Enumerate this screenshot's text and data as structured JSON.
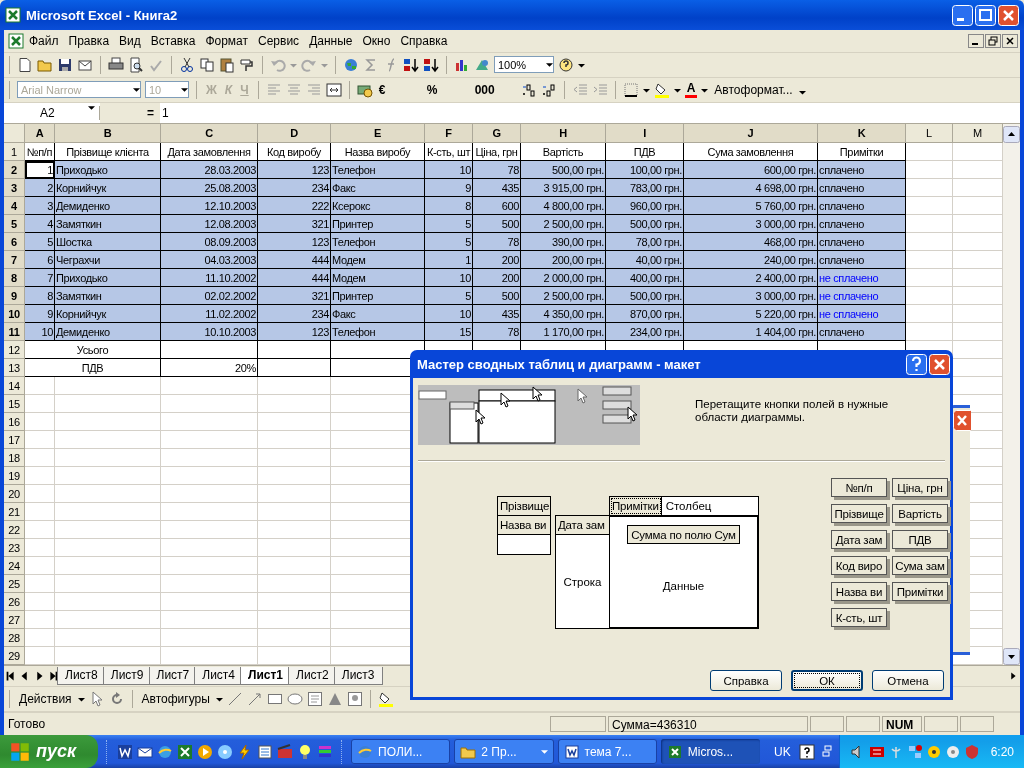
{
  "window": {
    "title": "Microsoft Excel - Книга2"
  },
  "menu": [
    "Файл",
    "Правка",
    "Вид",
    "Вставка",
    "Формат",
    "Сервис",
    "Данные",
    "Окно",
    "Справка"
  ],
  "standard_toolbar": {
    "zoom": "100%"
  },
  "formatting_toolbar": {
    "font": "Arial Narrow",
    "size": "10",
    "disabled": true,
    "style_buttons": [
      "Ж",
      "К",
      "Ч"
    ],
    "number_buttons": [
      "€",
      "%",
      "000"
    ],
    "font_color_button": "A",
    "autoformat": "Автоформат..."
  },
  "formula_bar": {
    "name_box": "A2",
    "equals": "=",
    "value": "1"
  },
  "sheet": {
    "columns": [
      {
        "label": "A",
        "selected": true
      },
      {
        "label": "B",
        "selected": true
      },
      {
        "label": "C",
        "selected": true
      },
      {
        "label": "D",
        "selected": true
      },
      {
        "label": "E",
        "selected": true
      },
      {
        "label": "F",
        "selected": true
      },
      {
        "label": "G",
        "selected": true
      },
      {
        "label": "H",
        "selected": true
      },
      {
        "label": "I",
        "selected": true
      },
      {
        "label": "J",
        "selected": true
      },
      {
        "label": "K",
        "selected": true
      },
      {
        "label": "L",
        "selected": false
      },
      {
        "label": "M",
        "selected": false
      }
    ],
    "rows": [
      {
        "n": "1",
        "kind": "header",
        "selected": false,
        "cells": [
          "№п/п",
          "Прізвище клієнта",
          "Дата замовлення",
          "Код виробу",
          "Назва виробу",
          "К-сть, шт",
          "Ціна, грн",
          "Вартість",
          "ПДВ",
          "Сума замовлення",
          "Примітки"
        ]
      },
      {
        "n": "2",
        "kind": "data",
        "selected": true,
        "active_cell": true,
        "flagged": false,
        "cells": [
          "1",
          "Приходько",
          "28.03.2003",
          "123",
          "Телефон",
          "10",
          "78",
          "500,00 грн.",
          "100,00 грн.",
          "600,00 грн.",
          "сплачено"
        ]
      },
      {
        "n": "3",
        "kind": "data",
        "selected": true,
        "active_cell": false,
        "flagged": false,
        "cells": [
          "2",
          "Корнийчук",
          "25.08.2003",
          "234",
          "Факс",
          "9",
          "435",
          "3 915,00 грн.",
          "783,00 грн.",
          "4 698,00 грн.",
          "сплачено"
        ]
      },
      {
        "n": "4",
        "kind": "data",
        "selected": true,
        "active_cell": false,
        "flagged": false,
        "cells": [
          "3",
          "Демиденко",
          "12.10.2003",
          "222",
          "Ксерокс",
          "8",
          "600",
          "4 800,00 грн.",
          "960,00 грн.",
          "5 760,00 грн.",
          "сплачено"
        ]
      },
      {
        "n": "5",
        "kind": "data",
        "selected": true,
        "active_cell": false,
        "flagged": false,
        "cells": [
          "4",
          "Замяткин",
          "12.08.2003",
          "321",
          "Принтер",
          "5",
          "500",
          "2 500,00 грн.",
          "500,00 грн.",
          "3 000,00 грн.",
          "сплачено"
        ]
      },
      {
        "n": "6",
        "kind": "data",
        "selected": true,
        "active_cell": false,
        "flagged": false,
        "cells": [
          "5",
          "Шостка",
          "08.09.2003",
          "123",
          "Телефон",
          "5",
          "78",
          "390,00 грн.",
          "78,00 грн.",
          "468,00 грн.",
          "сплачено"
        ]
      },
      {
        "n": "7",
        "kind": "data",
        "selected": true,
        "active_cell": false,
        "flagged": false,
        "cells": [
          "6",
          "Чеграхчи",
          "04.03.2003",
          "444",
          "Модем",
          "1",
          "200",
          "200,00 грн.",
          "40,00 грн.",
          "240,00 грн.",
          "сплачено"
        ]
      },
      {
        "n": "8",
        "kind": "data",
        "selected": true,
        "active_cell": false,
        "flagged": true,
        "cells": [
          "7",
          "Приходько",
          "11.10.2002",
          "444",
          "Модем",
          "10",
          "200",
          "2 000,00 грн.",
          "400,00 грн.",
          "2 400,00 грн.",
          "не сплачено"
        ]
      },
      {
        "n": "9",
        "kind": "data",
        "selected": true,
        "active_cell": false,
        "flagged": true,
        "cells": [
          "8",
          "Замяткин",
          "02.02.2002",
          "321",
          "Принтер",
          "5",
          "500",
          "2 500,00 грн.",
          "500,00 грн.",
          "3 000,00 грн.",
          "не сплачено"
        ]
      },
      {
        "n": "10",
        "kind": "data",
        "selected": true,
        "active_cell": false,
        "flagged": true,
        "cells": [
          "9",
          "Корнийчук",
          "11.02.2002",
          "234",
          "Факс",
          "10",
          "435",
          "4 350,00 грн.",
          "870,00 грн.",
          "5 220,00 грн.",
          "не сплачено"
        ]
      },
      {
        "n": "11",
        "kind": "data",
        "selected": true,
        "active_cell": false,
        "flagged": false,
        "cells": [
          "10",
          "Демиденко",
          "10.10.2003",
          "123",
          "Телефон",
          "15",
          "78",
          "1 170,00 грн.",
          "234,00 грн.",
          "1 404,00 грн.",
          "сплачено"
        ]
      },
      {
        "n": "12",
        "kind": "summary",
        "selected": false,
        "label": "Усього"
      },
      {
        "n": "13",
        "kind": "summary",
        "selected": false,
        "label": "ПДВ",
        "c": "20%"
      },
      {
        "n": "14",
        "kind": "empty",
        "selected": false
      },
      {
        "n": "15",
        "kind": "empty",
        "selected": false
      },
      {
        "n": "16",
        "kind": "empty",
        "selected": false
      },
      {
        "n": "17",
        "kind": "empty",
        "selected": false
      },
      {
        "n": "18",
        "kind": "empty",
        "selected": false
      },
      {
        "n": "19",
        "kind": "empty",
        "selected": false
      },
      {
        "n": "20",
        "kind": "empty",
        "selected": false
      },
      {
        "n": "21",
        "kind": "empty",
        "selected": false
      },
      {
        "n": "22",
        "kind": "empty",
        "selected": false
      },
      {
        "n": "23",
        "kind": "empty",
        "selected": false
      },
      {
        "n": "24",
        "kind": "empty",
        "selected": false
      },
      {
        "n": "25",
        "kind": "empty",
        "selected": false
      },
      {
        "n": "26",
        "kind": "empty",
        "selected": false
      },
      {
        "n": "27",
        "kind": "empty",
        "selected": false
      },
      {
        "n": "28",
        "kind": "empty",
        "selected": false
      },
      {
        "n": "29",
        "kind": "empty",
        "selected": false
      }
    ]
  },
  "sheet_tabs": [
    {
      "label": "Лист8",
      "selected": false
    },
    {
      "label": "Лист9",
      "selected": false
    },
    {
      "label": "Лист7",
      "selected": false
    },
    {
      "label": "Лист4",
      "selected": false
    },
    {
      "label": "Лист1",
      "selected": true
    },
    {
      "label": "Лист2",
      "selected": false
    },
    {
      "label": "Лист3",
      "selected": false
    }
  ],
  "drawing_toolbar": {
    "actions": "Действия",
    "autoshapes": "Автофигуры"
  },
  "status_bar": {
    "text": "Готово",
    "sum": "Сумма=436310",
    "num": "NUM"
  },
  "dialog": {
    "title": "Мастер сводных таблиц и диаграмм - макет",
    "instruction": "Перетащите кнопки полей в нужные области диаграммы.",
    "page_fields": [
      "Прізвище",
      "Назва ви"
    ],
    "row_area": {
      "label": "Строка",
      "fields": [
        "Дата зам"
      ]
    },
    "column_area": {
      "label": "Столбец",
      "fields": [
        {
          "label": "Примітки",
          "selected": true
        }
      ]
    },
    "data_area": {
      "label": "Данные",
      "fields": [
        "Сумма по полю Сум"
      ]
    },
    "field_buttons": [
      "№п/п",
      "Ціна, грн",
      "Прізвище",
      "Вартість",
      "Дата зам",
      "ПДВ",
      "Код виро",
      "Сума зам",
      "Назва ви",
      "Примітки",
      "К-сть, шт"
    ],
    "buttons": [
      {
        "label": "Справка",
        "default": false
      },
      {
        "label": "ОК",
        "default": true
      },
      {
        "label": "Отмена",
        "default": false
      }
    ]
  },
  "taskbar": {
    "start": "пуск",
    "tasks": [
      {
        "label": "ПОЛИ...",
        "kind": "browser",
        "menu": false,
        "selected": false
      },
      {
        "label": "2 Пр...",
        "kind": "folder",
        "menu": true,
        "selected": false
      },
      {
        "label": "тема 7...",
        "kind": "document",
        "menu": false,
        "selected": false
      },
      {
        "label": "Micros...",
        "kind": "spreadsheet",
        "menu": false,
        "selected": true
      }
    ],
    "language": "UK",
    "clock": "6:20"
  }
}
